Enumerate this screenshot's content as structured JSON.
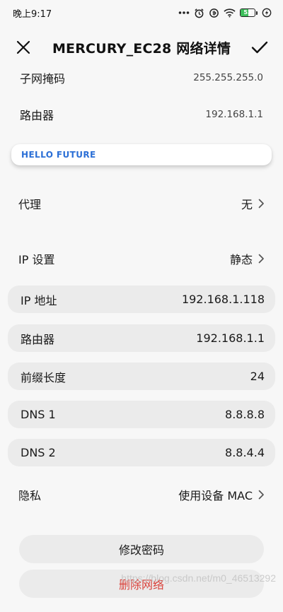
{
  "status_bar": {
    "time": "晚上9:17",
    "battery_level": "53",
    "battery_fraction": 0.53,
    "icons": [
      "more-dots-icon",
      "alarm-icon",
      "data-saver-icon",
      "wifi-icon",
      "battery-icon",
      "charging-icon"
    ]
  },
  "header": {
    "title": "MERCURY_EC28 网络详情",
    "close_icon": "close-icon",
    "confirm_icon": "check-icon"
  },
  "info": {
    "subnet_label": "子网掩码",
    "subnet_value": "255.255.255.0",
    "router_label": "路由器",
    "router_value": "192.168.1.1"
  },
  "banner": {
    "text": "HELLO  FUTURE"
  },
  "proxy": {
    "label": "代理",
    "value": "无"
  },
  "ip_settings": {
    "label": "IP 设置",
    "value": "静态"
  },
  "fields": [
    {
      "label": "IP 地址",
      "value": "192.168.1.118"
    },
    {
      "label": "路由器",
      "value": "192.168.1.1"
    },
    {
      "label": "前缀长度",
      "value": "24"
    },
    {
      "label": "DNS 1",
      "value": "8.8.8.8"
    },
    {
      "label": "DNS 2",
      "value": "8.8.4.4"
    }
  ],
  "privacy": {
    "label": "隐私",
    "value": "使用设备 MAC"
  },
  "buttons": {
    "change_password": "修改密码",
    "delete_network": "删除网络"
  },
  "watermark": "https://blog.csdn.net/m0_46513292",
  "colors": {
    "accent_blue": "#2b6fd6",
    "danger_red": "#d9413a",
    "pill_bg": "#ebebeb",
    "page_bg": "#f7f7f7",
    "battery_green": "#3cbf5a"
  }
}
